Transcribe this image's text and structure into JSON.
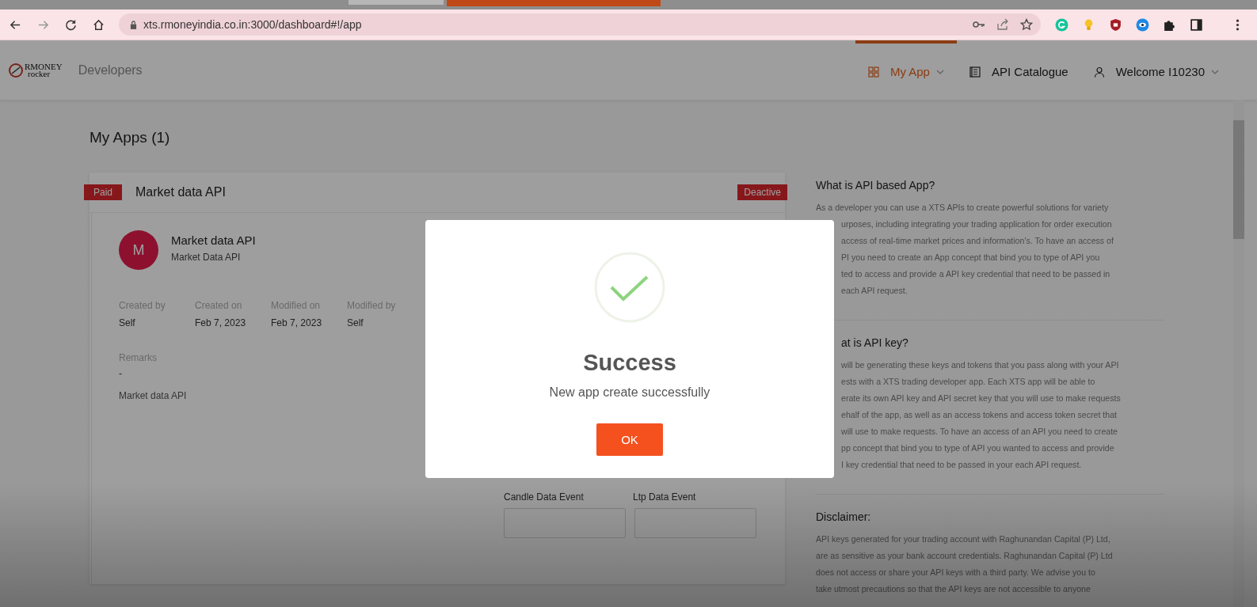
{
  "browser": {
    "url": "xts.rmoneyindia.co.in:3000/dashboard#!/app"
  },
  "header": {
    "logo": {
      "line_1": "RMONEY",
      "line_2": "rocker"
    },
    "brand": "Developers",
    "nav": [
      {
        "kind": "grid",
        "label": "My App",
        "selected": true,
        "dropdown": true
      },
      {
        "kind": "catalogue",
        "label": "API Catalogue",
        "selected": false,
        "dropdown": false
      },
      {
        "kind": "user",
        "label": "Welcome I10230",
        "selected": false,
        "dropdown": true
      }
    ]
  },
  "page_title": "My Apps (1)",
  "app_card": {
    "plan": "Paid",
    "name": "Market data API",
    "status": "Deactive",
    "avatar_letter": "M",
    "title": "Market data API",
    "subtitle": "Market Data API",
    "details": [
      {
        "label": "Created by",
        "value": "Self"
      },
      {
        "label": "Created on",
        "value": "Feb 7, 2023"
      },
      {
        "label": "Modified on",
        "value": "Feb 7, 2023"
      },
      {
        "label": "Modified by",
        "value": "Self"
      }
    ],
    "remarks_label": "Remarks",
    "remarks_value": "-",
    "description": "Market data API",
    "field_labels": [
      "Candle Data Event",
      "Ltp Data Event"
    ]
  },
  "info_panel": {
    "sections": [
      {
        "heading": {
          "text": "What is API based App?",
          "covered": false
        },
        "lines": [
          {
            "text": "As a developer you can use a XTS APIs to create powerful solutions for variety",
            "covered": false
          },
          {
            "text": "urposes, including integrating your trading application for order execution",
            "covered": true
          },
          {
            "text": "access of real-time market prices and information's. To have an access of",
            "covered": true
          },
          {
            "text": "PI you need to create an App concept that bind you to type of API you",
            "covered": true
          },
          {
            "text": "ted to access and provide a API key credential that need to be passed in",
            "covered": true
          },
          {
            "text": "each API request.",
            "covered": true
          }
        ]
      },
      {
        "heading": {
          "text": "at is API key?",
          "covered": true
        },
        "lines": [
          {
            "text": "will be generating these keys and tokens that you pass along with your API",
            "covered": true
          },
          {
            "text": "ests with a XTS trading developer app. Each XTS app will be able to",
            "covered": true
          },
          {
            "text": "erate its own API key and API secret key that you will use to make requests",
            "covered": true
          },
          {
            "text": "ehalf of the app, as well as an access tokens and access token secret that",
            "covered": true
          },
          {
            "text": "will use to make requests. To have an access of an API you need to create",
            "covered": true
          },
          {
            "text": "pp concept that bind you to type of API you wanted to access and provide",
            "covered": true
          },
          {
            "text": "I key credential that need to be passed in your each API request.",
            "covered": true
          }
        ]
      },
      {
        "heading": {
          "text": "Disclaimer:",
          "covered": false
        },
        "lines": [
          {
            "text": "API keys generated for your trading account with Raghunandan Capital (P) Ltd,",
            "covered": false
          },
          {
            "text": "are as sensitive as your bank account credentials. Raghunandan Capital (P) Ltd",
            "covered": false
          },
          {
            "text": "does not access or share your API keys with a third party. We advise you to",
            "covered": false
          },
          {
            "text": "take utmost precautions so that the API keys are not accessible to anyone",
            "covered": false
          }
        ]
      }
    ]
  },
  "dialog": {
    "title": "Success",
    "message": "New app create successfully",
    "button": "OK"
  }
}
